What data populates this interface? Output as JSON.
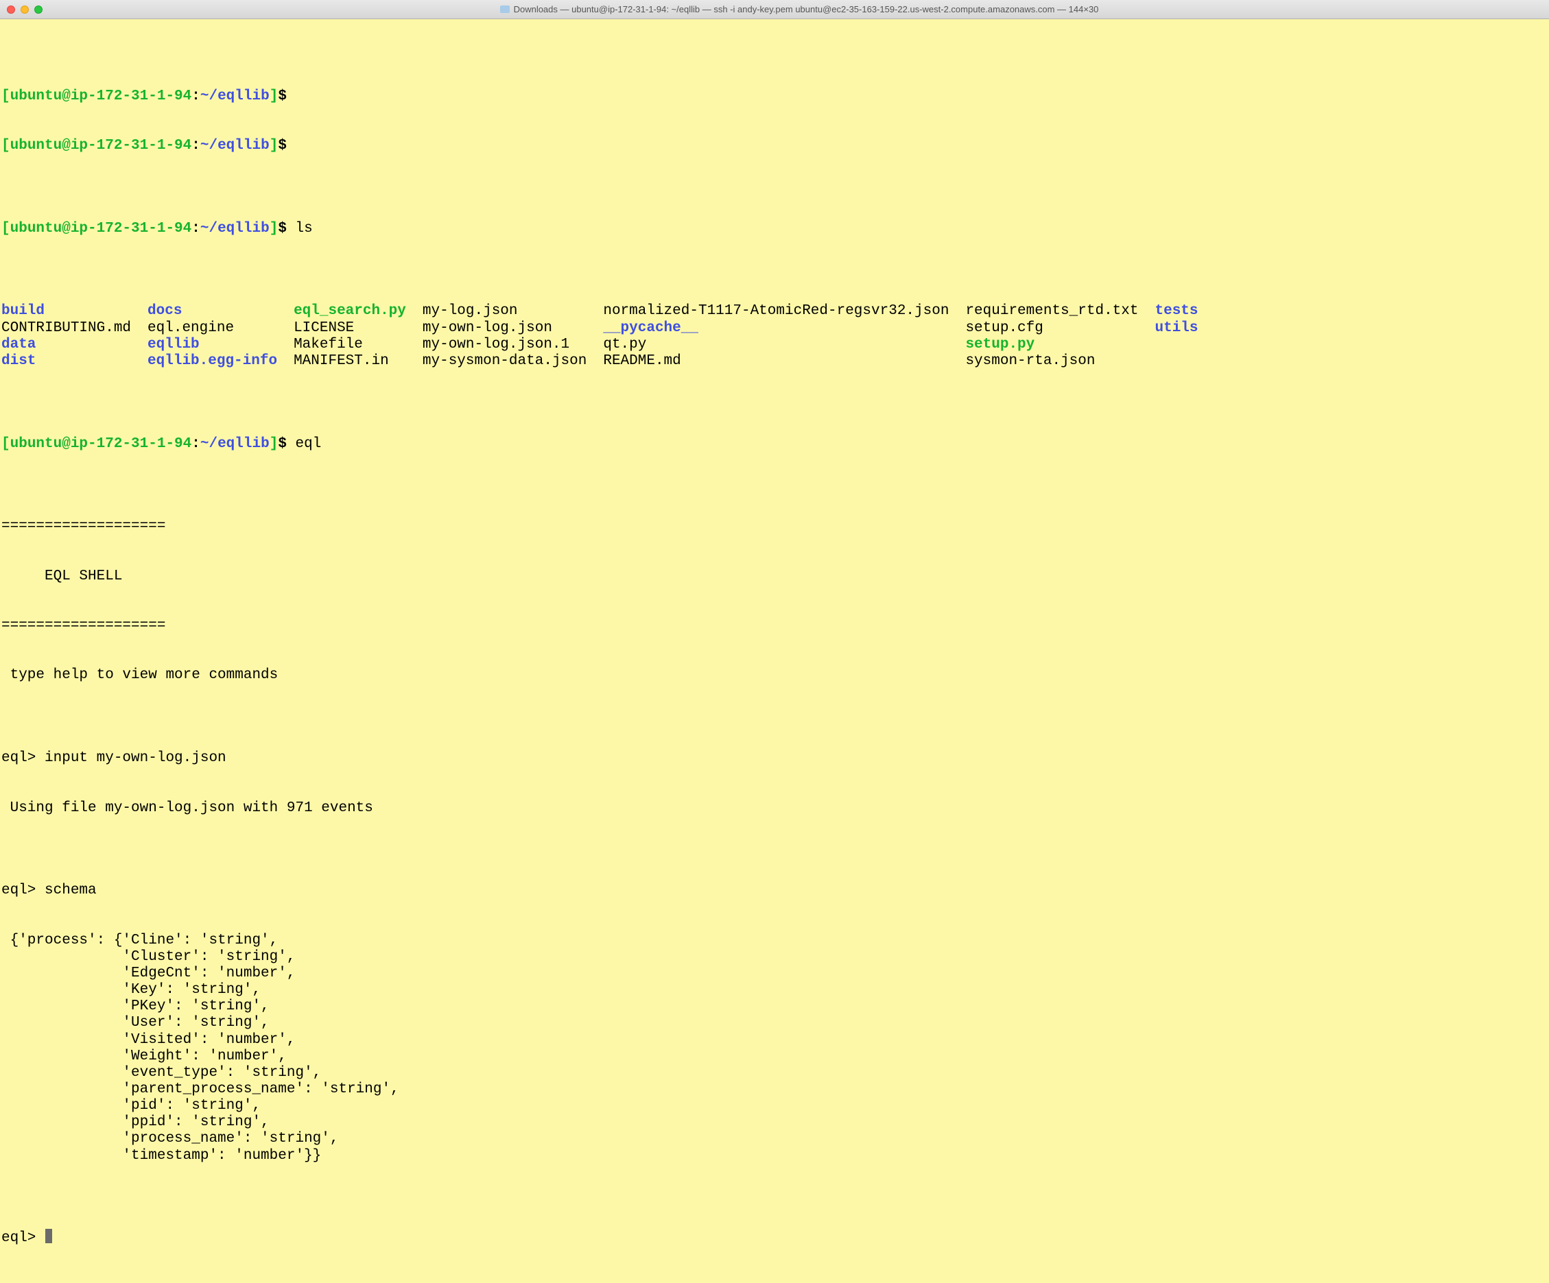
{
  "window": {
    "title": "Downloads — ubuntu@ip-172-31-1-94: ~/eqllib — ssh -i andy-key.pem ubuntu@ec2-35-163-159-22.us-west-2.compute.amazonaws.com — 144×30"
  },
  "prompt": {
    "bracket_open": "[",
    "bracket_close": "]",
    "user_host": "ubuntu@ip-172-31-1-94",
    "colon": ":",
    "path": "~/eqllib",
    "dollar": "$ "
  },
  "commands": {
    "ls": "ls",
    "eql": "eql"
  },
  "ls_columns": [
    [
      {
        "text": "build",
        "cls": "dir"
      },
      {
        "text": "CONTRIBUTING.md",
        "cls": "plain"
      },
      {
        "text": "data",
        "cls": "dir"
      },
      {
        "text": "dist",
        "cls": "dir"
      }
    ],
    [
      {
        "text": "docs",
        "cls": "dir"
      },
      {
        "text": "eql.engine",
        "cls": "plain"
      },
      {
        "text": "eqllib",
        "cls": "dir"
      },
      {
        "text": "eqllib.egg-info",
        "cls": "dir"
      }
    ],
    [
      {
        "text": "eql_search.py",
        "cls": "exec"
      },
      {
        "text": "LICENSE",
        "cls": "plain"
      },
      {
        "text": "Makefile",
        "cls": "plain"
      },
      {
        "text": "MANIFEST.in",
        "cls": "plain"
      }
    ],
    [
      {
        "text": "my-log.json",
        "cls": "plain"
      },
      {
        "text": "my-own-log.json",
        "cls": "plain"
      },
      {
        "text": "my-own-log.json.1",
        "cls": "plain"
      },
      {
        "text": "my-sysmon-data.json",
        "cls": "plain"
      }
    ],
    [
      {
        "text": "normalized-T1117-AtomicRed-regsvr32.json",
        "cls": "plain"
      },
      {
        "text": "__pycache__",
        "cls": "dir"
      },
      {
        "text": "qt.py",
        "cls": "plain"
      },
      {
        "text": "README.md",
        "cls": "plain"
      }
    ],
    [
      {
        "text": "requirements_rtd.txt",
        "cls": "plain"
      },
      {
        "text": "setup.cfg",
        "cls": "plain"
      },
      {
        "text": "setup.py",
        "cls": "exec"
      },
      {
        "text": "sysmon-rta.json",
        "cls": "plain"
      }
    ],
    [
      {
        "text": "tests",
        "cls": "dir"
      },
      {
        "text": "utils",
        "cls": "dir"
      }
    ]
  ],
  "eql_shell": {
    "banner_rule": "===================",
    "banner_title": "     EQL SHELL     ",
    "help_line": " type help to view more commands",
    "prompt": "eql> ",
    "input_cmd": "input my-own-log.json",
    "input_resp": " Using file my-own-log.json with 971 events",
    "schema_cmd": "schema",
    "schema_lines": [
      " {'process': {'Cline': 'string',",
      "              'Cluster': 'string',",
      "              'EdgeCnt': 'number',",
      "              'Key': 'string',",
      "              'PKey': 'string',",
      "              'User': 'string',",
      "              'Visited': 'number',",
      "              'Weight': 'number',",
      "              'event_type': 'string',",
      "              'parent_process_name': 'string',",
      "              'pid': 'string',",
      "              'ppid': 'string',",
      "              'process_name': 'string',",
      "              'timestamp': 'number'}}"
    ]
  }
}
